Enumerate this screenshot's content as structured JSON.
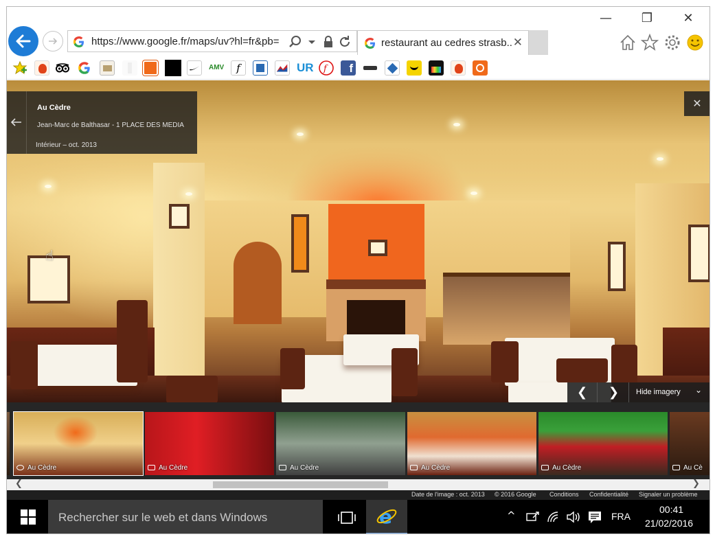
{
  "window": {
    "controls": [
      "—",
      "❐",
      "✕"
    ]
  },
  "browser": {
    "url": "https://www.google.fr/maps/uv?hl=fr&pb=",
    "tab_title": "restaurant au cedres strasb...",
    "tab_close": "✕"
  },
  "favorites": [
    "star-add-icon",
    "flame-icon",
    "tripadvisor-icon",
    "google-icon",
    "mail-icon",
    "blank-icon",
    "package-icon",
    "black-square-icon",
    "nike-icon",
    "amv-icon",
    "f-italic-icon",
    "plane-icon",
    "chart-icon",
    "ur-icon",
    "flash-icon",
    "facebook-icon",
    "router-icon",
    "blue-diamond-icon",
    "smile-icon",
    "bag-icon",
    "flame-icon-2",
    "orange-box-icon"
  ],
  "favorites_amv_label": "AMV",
  "streetview": {
    "place_name": "Au Cèdre",
    "subtitle": "Jean-Marc de Balthasar - 1 PLACE DES MEDIA",
    "date": "Intérieur – oct. 2013",
    "close": "✕",
    "prev": "❮",
    "next": "❯",
    "hide_imagery": "Hide imagery",
    "hide_chevron": "⌄"
  },
  "thumbnails": [
    {
      "label": "Au Cèdre",
      "type": "360"
    },
    {
      "label": "Au Cèdre",
      "type": "photo"
    },
    {
      "label": "Au Cèdre",
      "type": "photo"
    },
    {
      "label": "Au Cèdre",
      "type": "photo"
    },
    {
      "label": "Au Cèdre",
      "type": "photo"
    },
    {
      "label": "Au Cè",
      "type": "photo"
    }
  ],
  "footer": {
    "image_date": "Date de l'image : oct. 2013",
    "copyright": "© 2016 Google",
    "conditions": "Conditions",
    "privacy": "Confidentialité",
    "report": "Signaler un problème"
  },
  "taskbar": {
    "search_placeholder": "Rechercher sur le web et dans Windows",
    "language": "FRA",
    "time": "00:41",
    "date": "21/02/2016"
  },
  "colors": {
    "back_button": "#1e7cd6",
    "taskbar": "#000000",
    "panel": "#1e1e1e"
  }
}
